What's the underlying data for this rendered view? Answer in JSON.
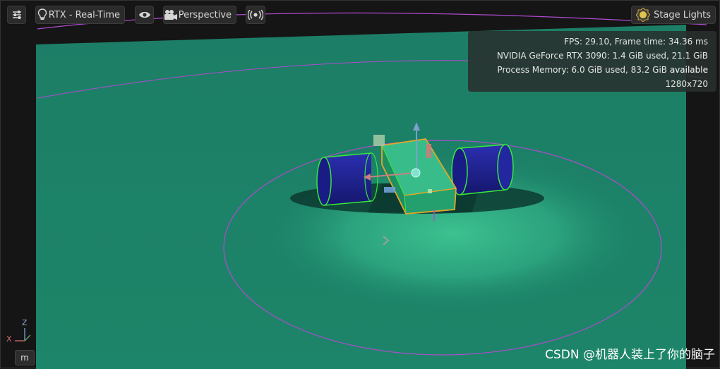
{
  "toolbar": {
    "settings_icon": "sliders-icon",
    "renderer_label": "RTX - Real-Time",
    "renderer_icon": "lightbulb-icon",
    "visibility_icon": "eye-icon",
    "camera_label": "Perspective",
    "camera_icon": "camera-icon",
    "broadcast_icon": "broadcast-icon",
    "lights_label": "Stage Lights",
    "lights_icon": "sun-icon"
  },
  "stats": {
    "fps": "FPS: 29.10, Frame time: 34.36 ms",
    "gpu": "NVIDIA GeForce RTX 3090: 1.4 GiB used, 21.1 GiB available",
    "memory": "Process Memory: 6.0 GiB used, 83.2 GiB available",
    "resolution": "1280x720"
  },
  "axis": {
    "z": "Z",
    "x": "X"
  },
  "units": {
    "label": "m"
  },
  "watermark": "CSDN @机器人装上了你的脑子",
  "colors": {
    "ground": "#1f8a6e",
    "spotlight": "#34b889",
    "wheel": "#1e2196",
    "chassis": "#2eb07e",
    "selection": "#e2a72a",
    "outline": "#39e83a",
    "guide": "#b04bd0"
  }
}
